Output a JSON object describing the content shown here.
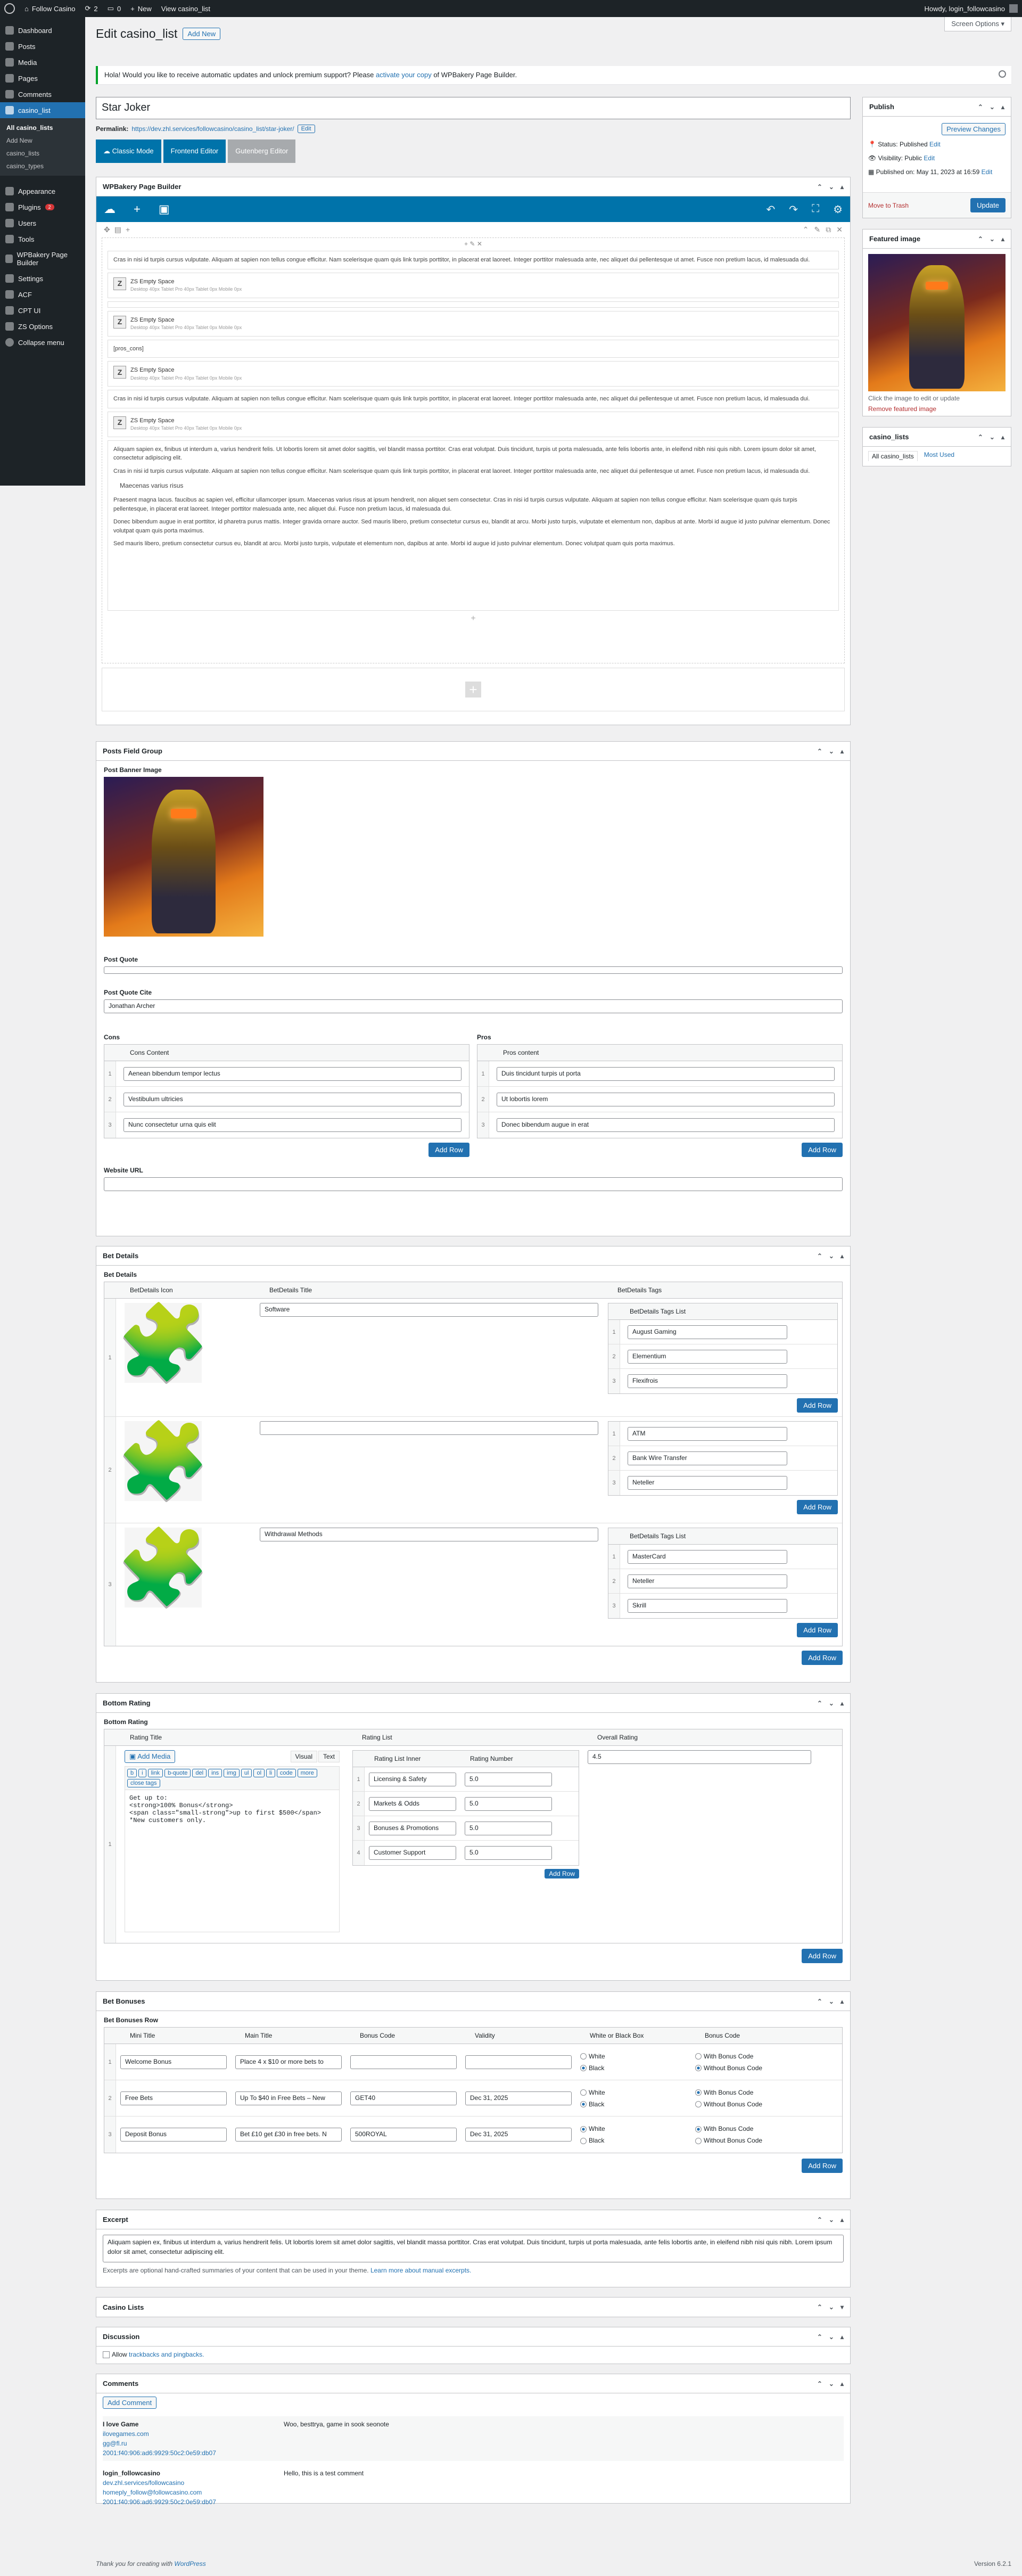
{
  "adminbar": {
    "site": "Follow Casino",
    "updates": "2",
    "comments": "0",
    "new": "New",
    "view": "View casino_list",
    "howdy": "Howdy, login_followcasino"
  },
  "sidebar": {
    "items": [
      {
        "label": "Dashboard"
      },
      {
        "label": "Posts"
      },
      {
        "label": "Media"
      },
      {
        "label": "Pages"
      },
      {
        "label": "Comments"
      },
      {
        "label": "casino_list"
      }
    ],
    "sub": [
      "All casino_lists",
      "Add New",
      "casino_lists",
      "casino_types"
    ],
    "items2": [
      {
        "label": "Appearance"
      },
      {
        "label": "Plugins",
        "badge": "2"
      },
      {
        "label": "Users"
      },
      {
        "label": "Tools"
      },
      {
        "label": "WPBakery Page Builder"
      },
      {
        "label": "Settings"
      },
      {
        "label": "ACF"
      },
      {
        "label": "CPT UI"
      },
      {
        "label": "ZS Options"
      },
      {
        "label": "Collapse menu"
      }
    ]
  },
  "header": {
    "title": "Edit casino_list",
    "add_new": "Add New",
    "screen_options": "Screen Options ▾"
  },
  "notice": {
    "text_pre": "Hola! Would you like to receive automatic updates and unlock premium support? Please ",
    "link": "activate your copy",
    "text_post": " of WPBakery Page Builder."
  },
  "post": {
    "title": "Star Joker",
    "permalink_label": "Permalink:",
    "permalink_url": "https://dev.zhl.services/followcasino/casino_list/star-joker/",
    "edit": "Edit"
  },
  "builder_buttons": {
    "classic": "Classic Mode",
    "frontend": "Frontend Editor",
    "gutenberg": "Gutenberg Editor"
  },
  "wpb": {
    "title": "WPBakery Page Builder",
    "lorem1": "Cras in nisi id turpis cursus vulputate. Aliquam at sapien non tellus congue efficitur. Nam scelerisque quam quis link turpis porttitor, in placerat erat laoreet. Integer porttitor malesuada ante, nec aliquet dui pellentesque ut amet. Fusce non pretium lacus, id malesuada dui.",
    "zs_title": "ZS Empty Space",
    "zs_sub": "Desktop 40px Tablet Pro 40px Tablet 0px Mobile 0px",
    "pros_cons": "[pros_cons]",
    "lorem2": "Aliquam sapien ex, finibus ut interdum a, varius hendrerit felis. Ut lobortis lorem sit amet dolor sagittis, vel blandit massa porttitor. Cras erat volutpat. Duis tincidunt, turpis ut porta malesuada, ante felis lobortis ante, in eleifend nibh nisi quis nibh. Lorem ipsum dolor sit amet, consectetur adipiscing elit.",
    "maecenas": "Maecenas varius risus",
    "praesent": "Praesent magna lacus. faucibus ac sapien vel, efficitur ullamcorper ipsum. Maecenas varius risus at ipsum hendrerit, non aliquet sem consectetur. Cras in nisi id turpis cursus vulputate. Aliquam at sapien non tellus congue efficitur. Nam scelerisque quam quis turpis pellentesque, in placerat erat laoreet. Integer porttitor malesuada ante, nec aliquet dui. Fusce non pretium lacus, id malesuada dui.",
    "donec": "Donec bibendum augue in erat porttitor, id pharetra purus mattis. Integer gravida ornare auctor. Sed mauris libero, pretium consectetur cursus eu, blandit at arcu. Morbi justo turpis, vulputate et elementum non, dapibus at ante. Morbi id augue id justo pulvinar elementum. Donec volutpat quam quis porta maximus.",
    "sed": "Sed mauris libero, pretium consectetur cursus eu, blandit at arcu. Morbi justo turpis, vulputate et elementum non, dapibus at ante. Morbi id augue id justo pulvinar elementum. Donec volutpat quam quis porta maximus."
  },
  "publish": {
    "title": "Publish",
    "preview": "Preview Changes",
    "status": "Status: Published",
    "visibility": "Visibility: Public",
    "published": "Published on: May 11, 2023 at 16:59",
    "edit": "Edit",
    "trash": "Move to Trash",
    "update": "Update"
  },
  "featured": {
    "title": "Featured image",
    "hint": "Click the image to edit or update",
    "remove": "Remove featured image"
  },
  "casino_lists_box": {
    "title": "casino_lists",
    "tab1": "All casino_lists",
    "tab2": "Most Used"
  },
  "posts_field_group": {
    "title": "Posts Field Group",
    "banner_label": "Post Banner Image",
    "quote_label": "Post Quote",
    "quote_cite_label": "Post Quote Cite",
    "quote_cite": "Jonathan Archer",
    "cons_label": "Cons",
    "cons_col": "Cons Content",
    "cons": [
      "Aenean bibendum tempor lectus",
      "Vestibulum ultricies",
      "Nunc consectetur urna quis elit"
    ],
    "pros_label": "Pros",
    "pros_col": "Pros content",
    "pros": [
      "Duis tincidunt turpis ut porta",
      "Ut lobortis lorem",
      "Donec bibendum augue in erat"
    ],
    "add_row": "Add Row",
    "website_label": "Website URL"
  },
  "bet_details": {
    "title": "Bet Details",
    "sub": "Bet Details",
    "col_icon": "BetDetails Icon",
    "col_title": "BetDetails Title",
    "col_tags": "BetDetails Tags",
    "tags_list_label": "BetDetails Tags List",
    "rows": [
      {
        "title": "Software",
        "tags": [
          "August Gaming",
          "Elementium",
          "Flexifrois"
        ]
      },
      {
        "title": "",
        "tags": [
          "ATM",
          "Bank Wire Transfer",
          "Neteller"
        ]
      },
      {
        "title": "Withdrawal Methods",
        "tags": [
          "MasterCard",
          "Neteller",
          "Skrill"
        ]
      }
    ],
    "add_row": "Add Row"
  },
  "bottom_rating": {
    "title": "Bottom Rating",
    "sub": "Bottom Rating",
    "col_title": "Rating Title",
    "col_list": "Rating List",
    "col_overall": "Overall Rating",
    "add_media": "Add Media",
    "visual": "Visual",
    "text": "Text",
    "qt": [
      "b",
      "i",
      "link",
      "b-quote",
      "del",
      "ins",
      "img",
      "ul",
      "ol",
      "li",
      "code",
      "more",
      "close tags"
    ],
    "editor_text": "Get up to:\n<strong>100% Bonus</strong>\n<span class=\"small-strong\">up to first $500</span>\n*New customers only.",
    "inner_col": "Rating List Inner",
    "num_col": "Rating Number",
    "list": [
      {
        "label": "Licensing & Safety",
        "num": "5.0"
      },
      {
        "label": "Markets & Odds",
        "num": "5.0"
      },
      {
        "label": "Bonuses & Promotions",
        "num": "5.0"
      },
      {
        "label": "Customer Support",
        "num": "5.0"
      }
    ],
    "overall": "4.5",
    "add_row_small": "Add Row",
    "add_row": "Add Row"
  },
  "bet_bonuses": {
    "title": "Bet Bonuses",
    "sub": "Bet Bonuses Row",
    "cols": [
      "Mini Title",
      "Main Title",
      "Bonus Code",
      "Validity",
      "White or Black Box",
      "Bonus Code"
    ],
    "rows": [
      {
        "mini": "Welcome Bonus",
        "main": "Place 4 x $10 or more bets to",
        "code": "",
        "valid": "",
        "box": "Black",
        "bc": "Without Bonus Code"
      },
      {
        "mini": "Free Bets",
        "main": "Up To $40 in Free Bets – New",
        "code": "GET40",
        "valid": "Dec 31, 2025",
        "box": "Black",
        "bc": "With Bonus Code"
      },
      {
        "mini": "Deposit Bonus",
        "main": "Bet £10 get £30 in free bets. N",
        "code": "500ROYAL",
        "valid": "Dec 31, 2025",
        "box": "White",
        "bc": "With Bonus Code"
      }
    ],
    "opt_white": "White",
    "opt_black": "Black",
    "opt_with": "With Bonus Code",
    "opt_without": "Without Bonus Code",
    "add_row": "Add Row"
  },
  "excerpt": {
    "title": "Excerpt",
    "text": "Aliquam sapien ex, finibus ut interdum a, varius hendrerit felis. Ut lobortis lorem sit amet dolor sagittis, vel blandit massa porttitor. Cras erat volutpat. Duis tincidunt, turpis ut porta malesuada, ante felis lobortis ante, in eleifend nibh nisi quis nibh. Lorem ipsum dolor sit amet, consectetur adipiscing elit.",
    "help_pre": "Excerpts are optional hand-crafted summaries of your content that can be used in your theme. ",
    "help_link": "Learn more about manual excerpts."
  },
  "casino_lists_panel": {
    "title": "Casino Lists"
  },
  "discussion": {
    "title": "Discussion",
    "allow": "Allow ",
    "trackbacks": "trackbacks and pingbacks."
  },
  "comments": {
    "title": "Comments",
    "add": "Add Comment",
    "items": [
      {
        "author": "I love Game",
        "site": "ilovegames.com",
        "email": "gg@fl.ru",
        "ip": "2001:f40:906:ad6:9929:50c2:0e59:db07",
        "text": "Woo, besttrya, game in sook seonote"
      },
      {
        "author": "login_followcasino",
        "site": "dev.zhl.services/followcasino",
        "email": "homeply_follow@followcasino.com",
        "ip": "2001:f40:906:ad6:9929:50c2:0e59:db07",
        "text": "Hello, this is a test comment"
      }
    ]
  },
  "footer": {
    "thanks_pre": "Thank you for creating with ",
    "thanks_link": "WordPress",
    "version": "Version 6.2.1"
  }
}
